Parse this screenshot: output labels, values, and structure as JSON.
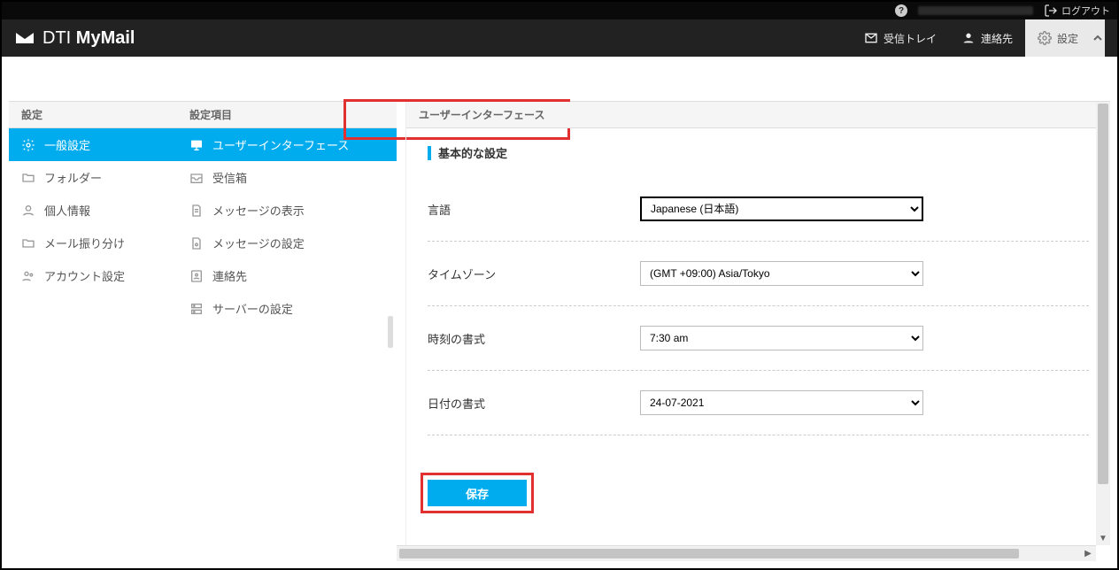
{
  "topbar": {
    "logout": "ログアウト"
  },
  "brand": {
    "prefix": "DTI ",
    "suffix": "MyMail"
  },
  "header_nav": {
    "inbox": "受信トレイ",
    "contacts": "連絡先",
    "settings": "設定"
  },
  "col1": {
    "title": "設定",
    "items": [
      {
        "label": "一般設定"
      },
      {
        "label": "フォルダー"
      },
      {
        "label": "個人情報"
      },
      {
        "label": "メール振り分け"
      },
      {
        "label": "アカウント設定"
      }
    ]
  },
  "col2": {
    "title": "設定項目",
    "items": [
      {
        "label": "ユーザーインターフェース"
      },
      {
        "label": "受信箱"
      },
      {
        "label": "メッセージの表示"
      },
      {
        "label": "メッセージの設定"
      },
      {
        "label": "連絡先"
      },
      {
        "label": "サーバーの設定"
      }
    ]
  },
  "panel": {
    "title": "ユーザーインターフェース",
    "section": "基本的な設定",
    "rows": {
      "language": {
        "label": "言語",
        "value": "Japanese (日本語)"
      },
      "timezone": {
        "label": "タイムゾーン",
        "value": "(GMT +09:00) Asia/Tokyo"
      },
      "timeformat": {
        "label": "時刻の書式",
        "value": "7:30 am"
      },
      "dateformat": {
        "label": "日付の書式",
        "value": "24-07-2021"
      }
    },
    "save": "保存"
  }
}
